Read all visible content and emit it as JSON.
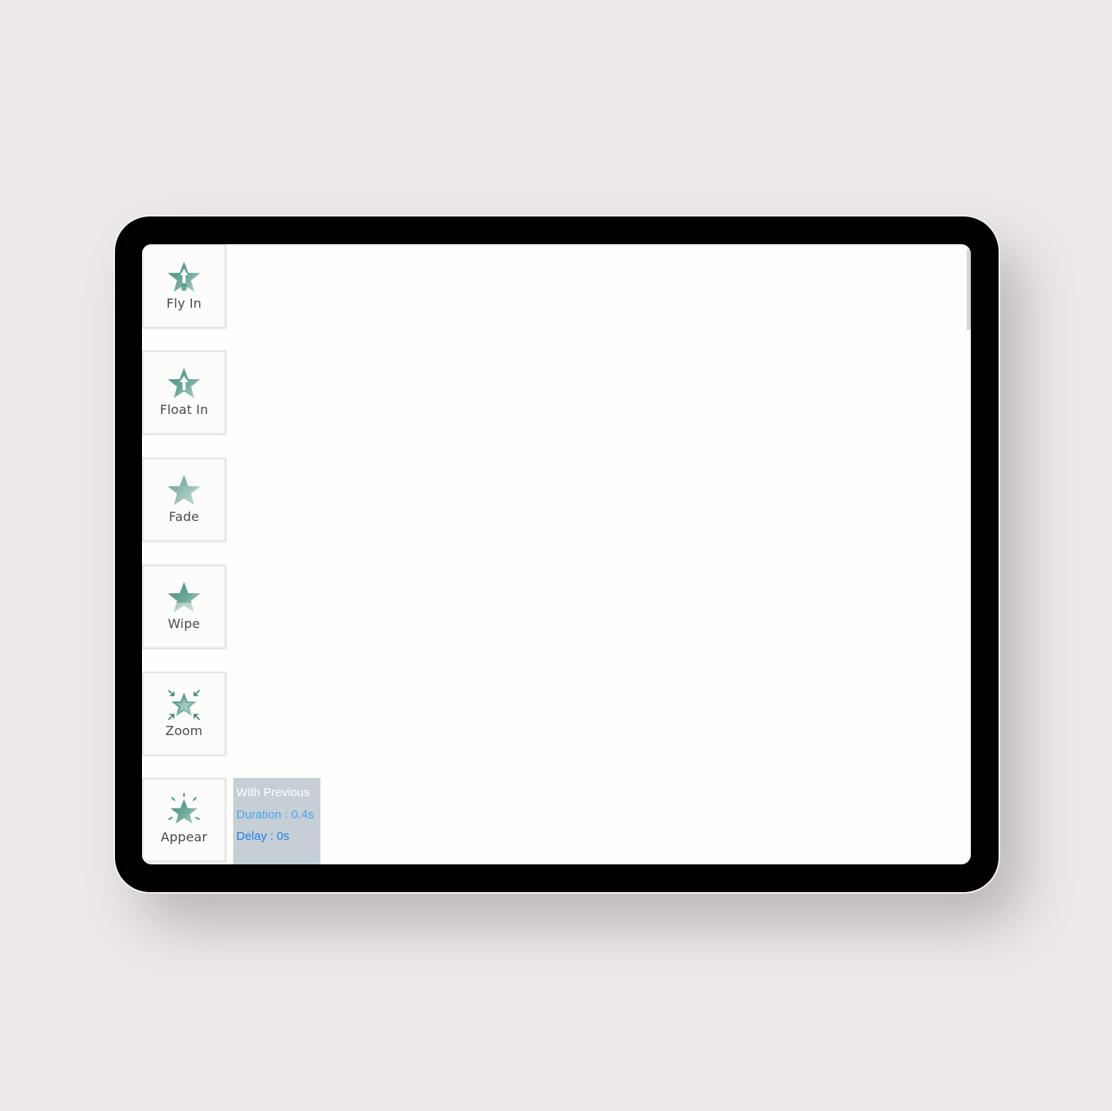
{
  "effects": [
    {
      "label": "Fly In",
      "icon": "fly-in-star-icon"
    },
    {
      "label": "Float In",
      "icon": "float-in-star-icon"
    },
    {
      "label": "Fade",
      "icon": "fade-star-icon"
    },
    {
      "label": "Wipe",
      "icon": "wipe-star-icon"
    },
    {
      "label": "Zoom",
      "icon": "zoom-star-icon"
    },
    {
      "label": "Appear",
      "icon": "appear-star-icon"
    }
  ],
  "timing": {
    "trigger": "With Previous",
    "duration": "Duration : 0.4s",
    "delay": "Delay : 0s"
  },
  "colors": {
    "star_teal": "#5f9e91",
    "panel_bg": "#c6cfd6",
    "duration_text": "#4aa3f0",
    "delay_text": "#1f80e5",
    "device_frame": "#000000",
    "page_bg": "#ede9e8"
  }
}
